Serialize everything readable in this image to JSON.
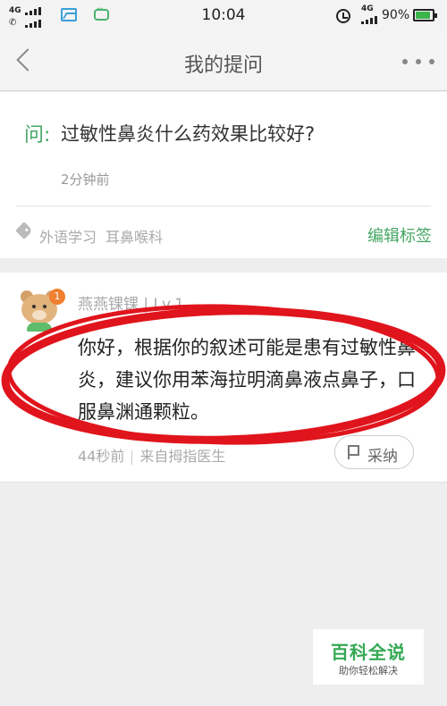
{
  "status_bar": {
    "network_left_top": "4G",
    "network_left_bottom": "",
    "time": "10:04",
    "network_right": "4G",
    "battery_percent": "90%",
    "battery_level": 0.9,
    "icons": [
      "gallery-icon",
      "message-icon",
      "alarm-icon"
    ]
  },
  "nav": {
    "title": "我的提问",
    "back_icon": "chevron-left-icon",
    "more_icon": "more-dots-icon"
  },
  "question": {
    "prefix": "问:",
    "text": "过敏性鼻炎什么药效果比较好?",
    "time": "2分钟前",
    "tags": [
      "外语学习",
      "耳鼻喉科"
    ],
    "edit_tags_label": "编辑标签"
  },
  "answer": {
    "badge_count": "1",
    "username": "燕燕锞锞 | Lv.1",
    "text": "你好，根据你的叙述可能是患有过敏性鼻炎，建议你用苯海拉明滴鼻液点鼻子，口服鼻渊通颗粒。",
    "time": "44秒前",
    "source": "来自拇指医生",
    "adopt_label": "采纳"
  },
  "watermark": {
    "title": "百科全说",
    "subtitle": "助你轻松解决"
  },
  "colors": {
    "accent_green": "#45a664",
    "highlight_red": "#e0141c",
    "badge_orange": "#f07f2f"
  }
}
